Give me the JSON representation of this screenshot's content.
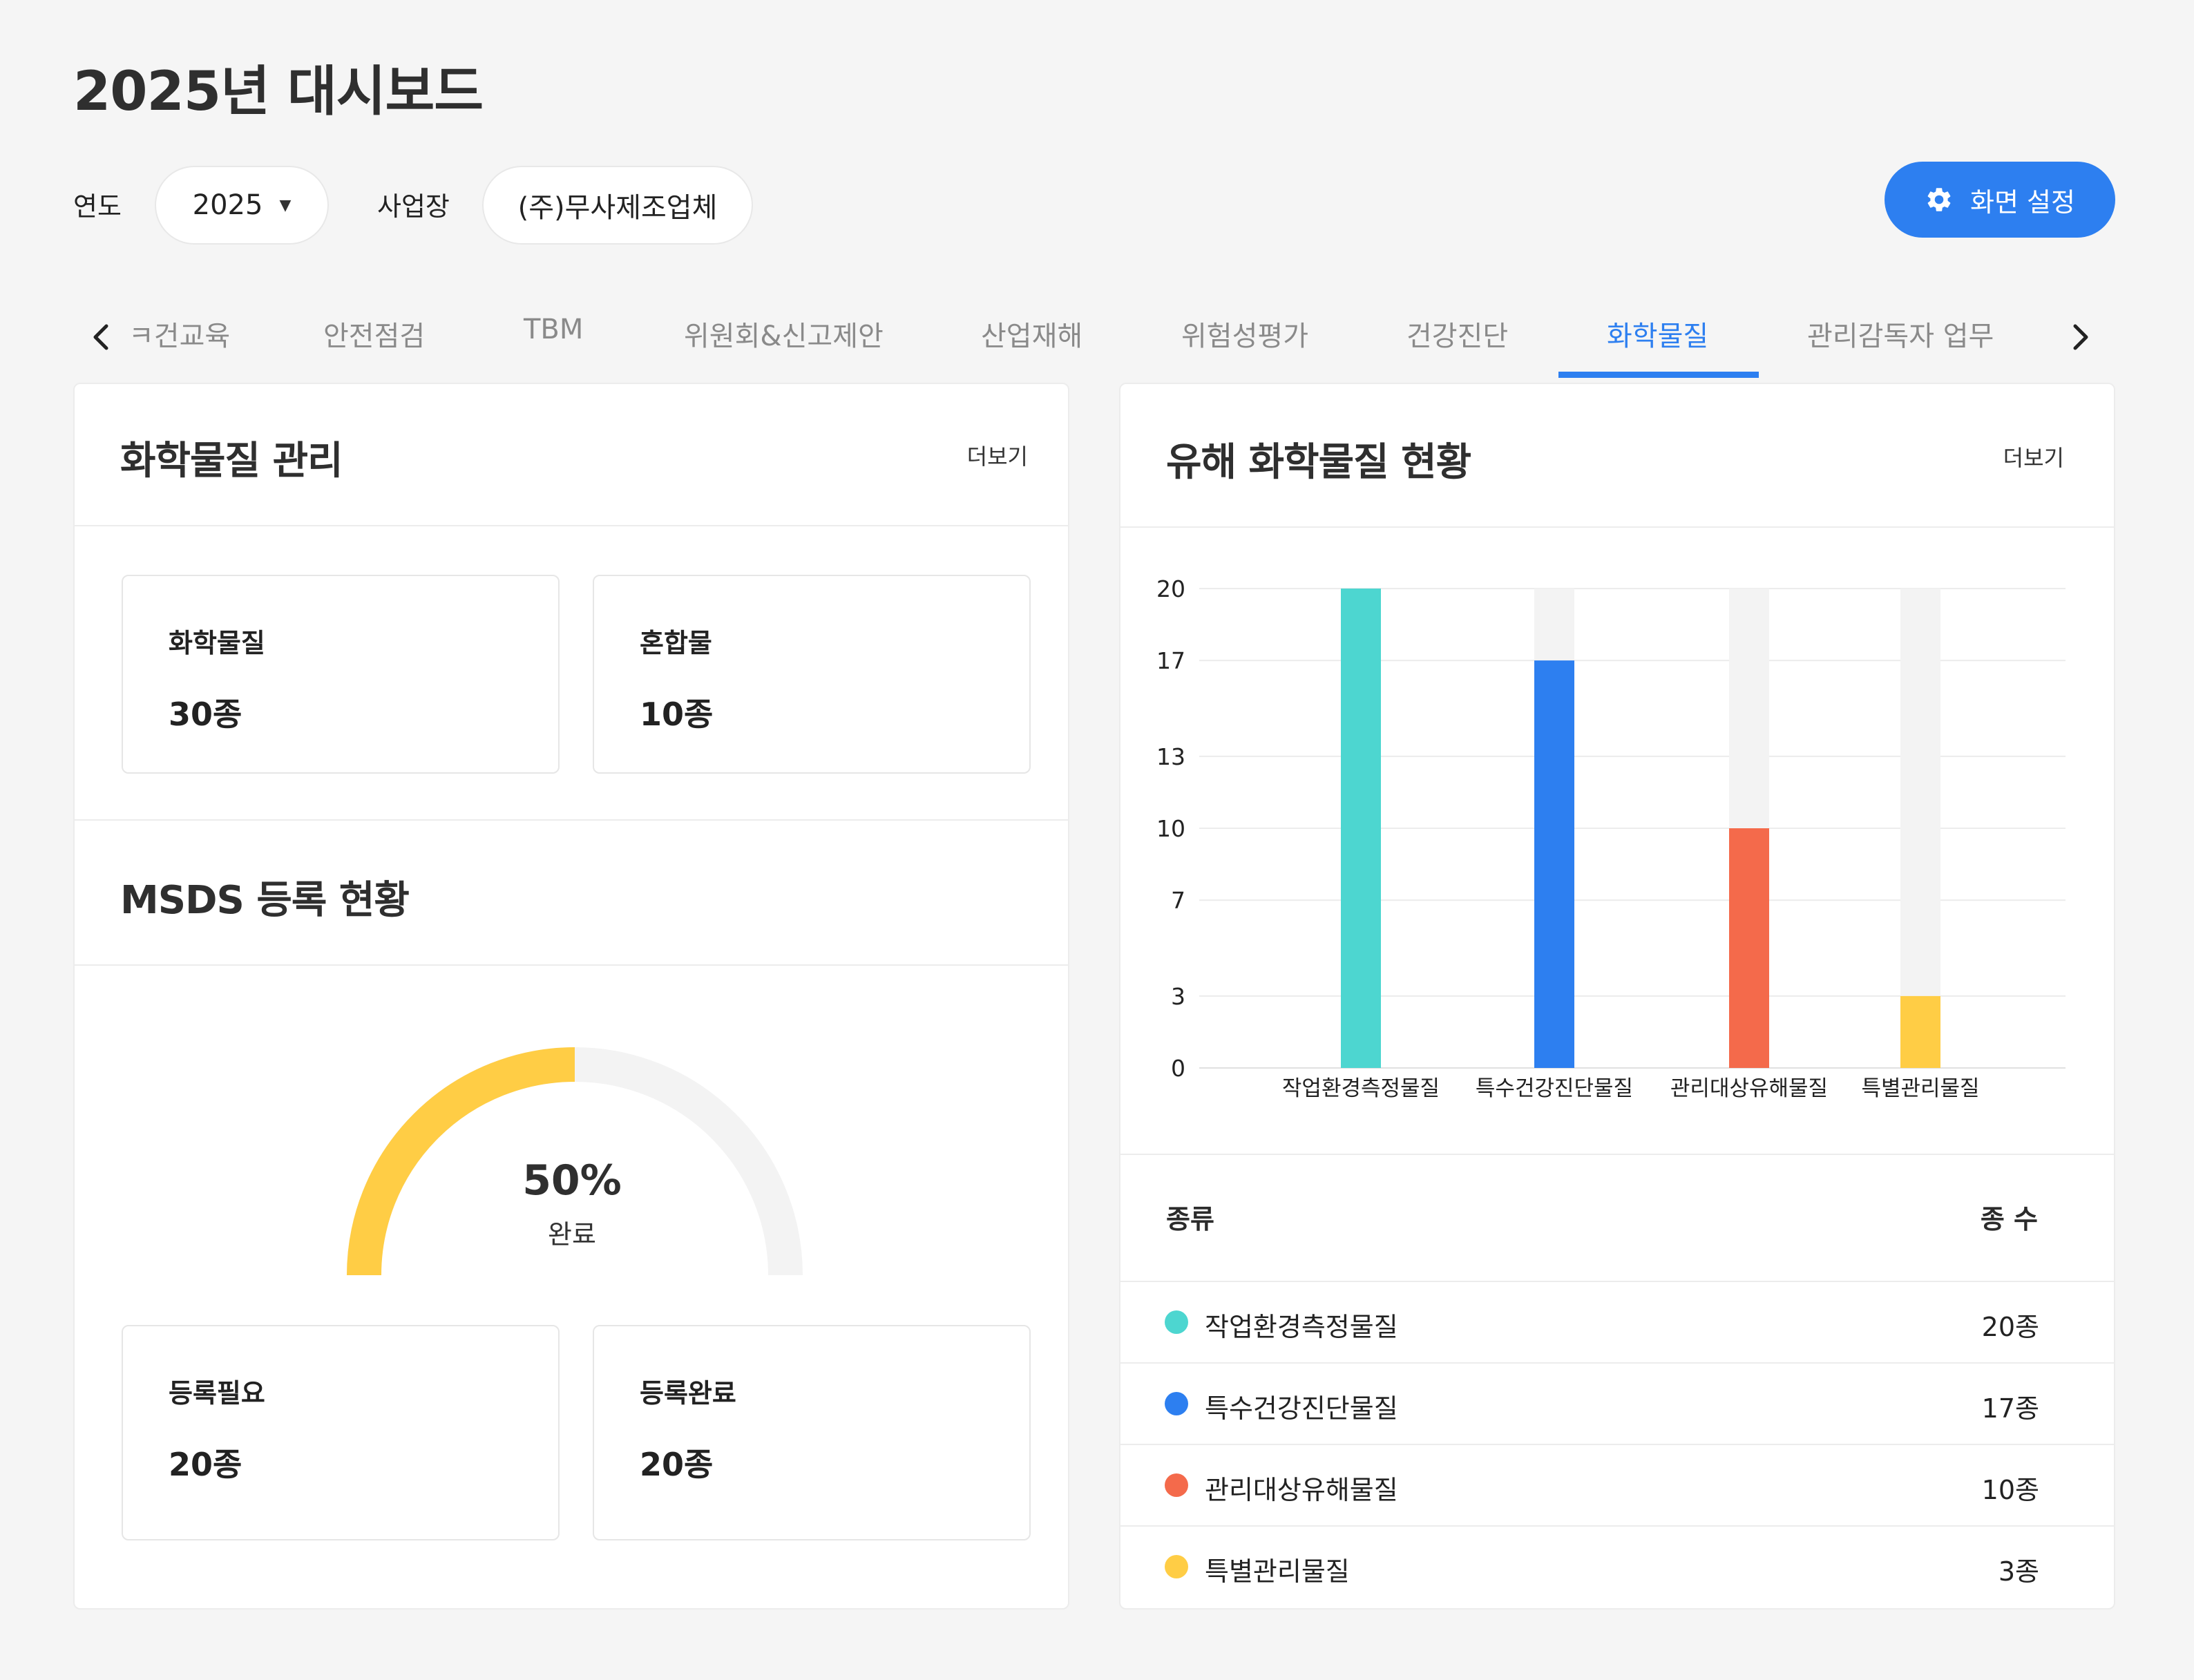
{
  "header": {
    "title": "2025년 대시보드"
  },
  "filters": {
    "year_label": "연도",
    "year_value": "2025",
    "site_label": "사업장",
    "site_value": "(주)무사제조업체"
  },
  "settings_button": {
    "label": "화면 설정",
    "icon": "gear-icon"
  },
  "tabs": [
    {
      "label": "ㅋ건교육"
    },
    {
      "label": "안전점검"
    },
    {
      "label": "TBM"
    },
    {
      "label": "위원회&신고제안"
    },
    {
      "label": "산업재해"
    },
    {
      "label": "위험성평가"
    },
    {
      "label": "건강진단"
    },
    {
      "label": "화학물질",
      "active": true
    },
    {
      "label": "관리감독자 업무"
    }
  ],
  "chem_card": {
    "title": "화학물질 관리",
    "more": "더보기",
    "stats": [
      {
        "label": "화학물질",
        "value": "30종"
      },
      {
        "label": "혼합물",
        "value": "10종"
      }
    ]
  },
  "msds_card": {
    "title": "MSDS 등록 현황",
    "gauge": {
      "percent": 50,
      "percent_label": "50%",
      "sub_label": "완료",
      "fill_color": "#ffcd45",
      "track_color": "#f3f3f3"
    },
    "stats": [
      {
        "label": "등록필요",
        "value": "20종"
      },
      {
        "label": "등록완료",
        "value": "20종"
      }
    ]
  },
  "hazard_card": {
    "title": "유해 화학물질 현황",
    "more": "더보기",
    "table": {
      "col_type": "종류",
      "col_count": "종 수",
      "rows": [
        {
          "name": "작업환경측정물질",
          "count": "20종",
          "color": "#4dd6d0"
        },
        {
          "name": "특수건강진단물질",
          "count": "17종",
          "color": "#2d7ff0"
        },
        {
          "name": "관리대상유해물질",
          "count": "10종",
          "color": "#f46a4b"
        },
        {
          "name": "특별관리물질",
          "count": "3종",
          "color": "#ffcd45"
        }
      ]
    }
  },
  "chart_data": {
    "type": "bar",
    "categories": [
      "작업환경측정물질",
      "특수건강진단물질",
      "관리대상유해물질",
      "특별관리물질"
    ],
    "values": [
      20,
      17,
      10,
      3
    ],
    "colors": [
      "#4dd6d0",
      "#2d7ff0",
      "#f46a4b",
      "#ffcd45"
    ],
    "yticks": [
      0,
      3,
      7,
      10,
      13,
      17,
      20
    ],
    "ylim": [
      0,
      20
    ],
    "grid": true,
    "background_track": true
  }
}
